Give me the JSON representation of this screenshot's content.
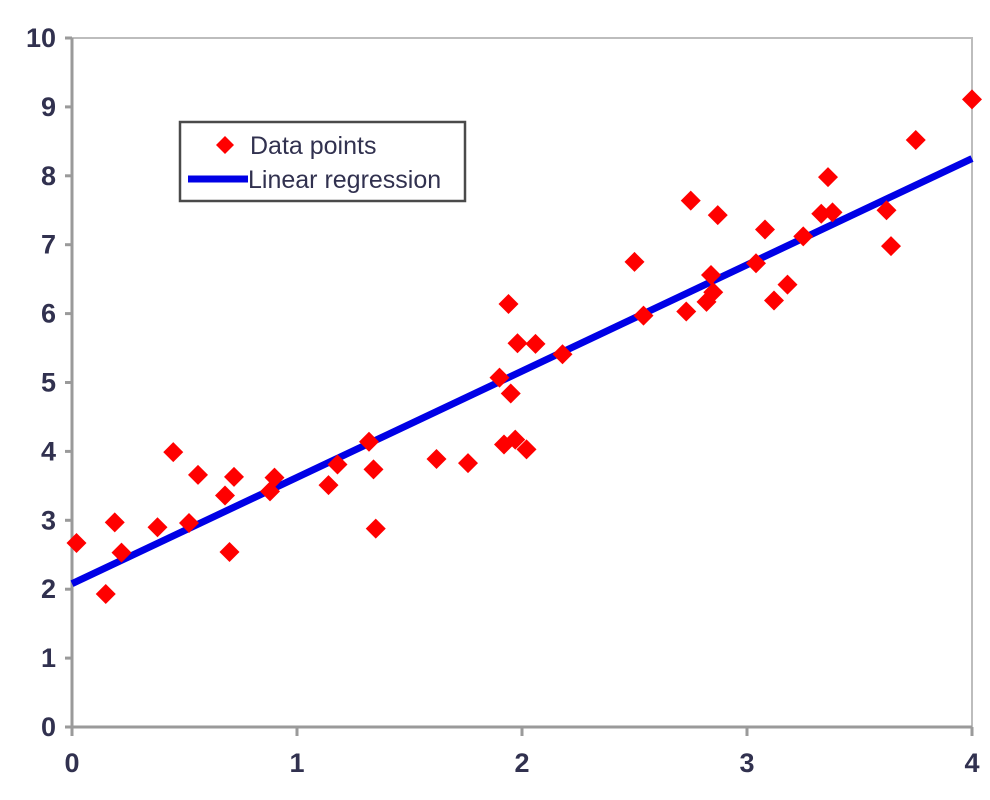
{
  "chart_data": {
    "type": "scatter",
    "title": "",
    "subtitle": "",
    "xlabel": "",
    "ylabel": "",
    "xlim": [
      0,
      4
    ],
    "ylim": [
      0,
      10
    ],
    "xticks": [
      0,
      1,
      2,
      3,
      4
    ],
    "yticks": [
      0,
      1,
      2,
      3,
      4,
      5,
      6,
      7,
      8,
      9,
      10
    ],
    "xtick_labels": [
      "0",
      "1",
      "2",
      "3",
      "4"
    ],
    "ytick_labels": [
      "0",
      "1",
      "2",
      "3",
      "4",
      "5",
      "6",
      "7",
      "8",
      "9",
      "10"
    ],
    "grid": false,
    "legend_position": "upper-left",
    "series": [
      {
        "name": "Data points",
        "type": "scatter",
        "marker": "diamond",
        "color": "#FF0000",
        "points": [
          [
            0.02,
            2.67
          ],
          [
            0.15,
            1.93
          ],
          [
            0.19,
            2.97
          ],
          [
            0.22,
            2.53
          ],
          [
            0.38,
            2.9
          ],
          [
            0.45,
            3.99
          ],
          [
            0.52,
            2.96
          ],
          [
            0.56,
            3.66
          ],
          [
            0.68,
            3.36
          ],
          [
            0.7,
            2.54
          ],
          [
            0.72,
            3.63
          ],
          [
            0.88,
            3.42
          ],
          [
            0.9,
            3.62
          ],
          [
            1.14,
            3.51
          ],
          [
            1.18,
            3.81
          ],
          [
            1.32,
            4.14
          ],
          [
            1.34,
            3.74
          ],
          [
            1.35,
            2.88
          ],
          [
            1.62,
            3.89
          ],
          [
            1.76,
            3.83
          ],
          [
            1.9,
            5.07
          ],
          [
            1.92,
            4.1
          ],
          [
            1.94,
            6.14
          ],
          [
            1.95,
            4.84
          ],
          [
            1.97,
            4.17
          ],
          [
            1.98,
            5.57
          ],
          [
            2.02,
            4.03
          ],
          [
            2.06,
            5.56
          ],
          [
            2.18,
            5.41
          ],
          [
            2.5,
            6.75
          ],
          [
            2.54,
            5.97
          ],
          [
            2.73,
            6.03
          ],
          [
            2.75,
            7.64
          ],
          [
            2.82,
            6.17
          ],
          [
            2.84,
            6.56
          ],
          [
            2.85,
            6.31
          ],
          [
            2.87,
            7.43
          ],
          [
            3.04,
            6.73
          ],
          [
            3.08,
            7.22
          ],
          [
            3.12,
            6.19
          ],
          [
            3.18,
            6.42
          ],
          [
            3.25,
            7.12
          ],
          [
            3.33,
            7.45
          ],
          [
            3.36,
            7.98
          ],
          [
            3.38,
            7.47
          ],
          [
            3.62,
            7.5
          ],
          [
            3.64,
            6.98
          ],
          [
            3.75,
            8.52
          ],
          [
            4.0,
            9.11
          ]
        ]
      },
      {
        "name": "Linear regression",
        "type": "line",
        "color": "#0000E6",
        "slope": 1.54,
        "intercept": 2.08,
        "x": [
          0,
          4
        ],
        "y": [
          2.08,
          8.25
        ]
      }
    ]
  },
  "legend": {
    "entries": [
      {
        "label": "Data points",
        "symbol": "diamond-marker",
        "color": "#FF0000"
      },
      {
        "label": "Linear regression",
        "symbol": "line-swatch",
        "color": "#0000E6"
      }
    ]
  },
  "colors": {
    "marker": "#FF0000",
    "line": "#0000E6",
    "axis": "#9a9a9a",
    "border": "#bdbdbd",
    "text": "#31314f",
    "legend_border": "#4a4a4a",
    "background": "#ffffff"
  }
}
